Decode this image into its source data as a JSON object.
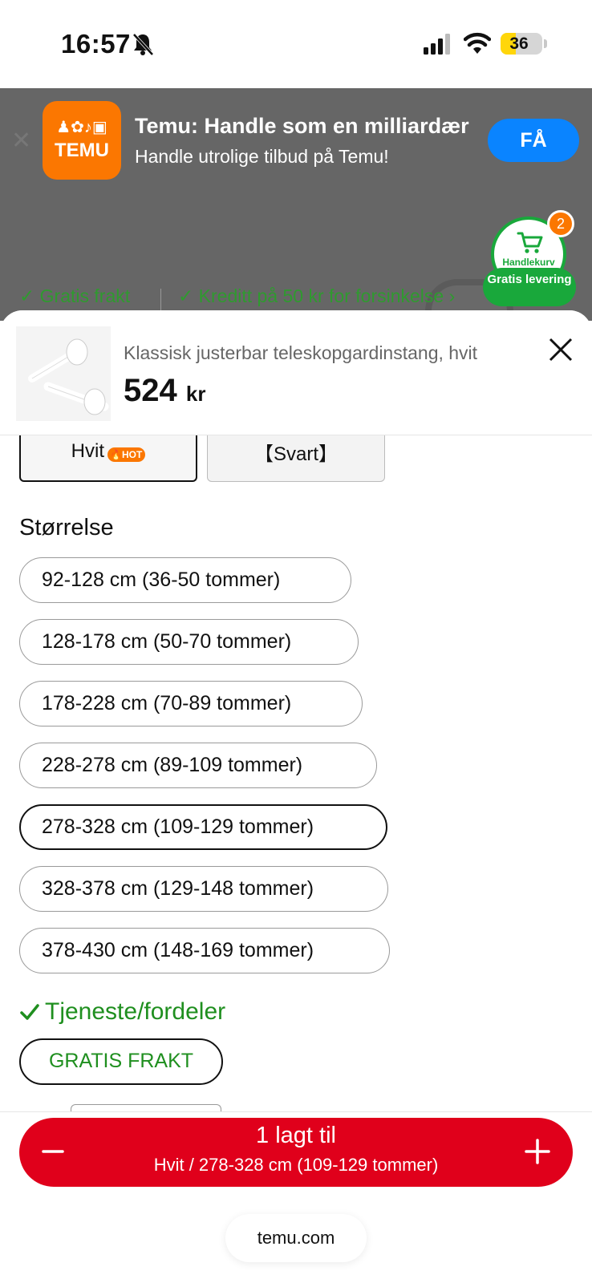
{
  "status_bar": {
    "time": "16:57",
    "battery": "36",
    "battery_level": 0.36
  },
  "app_banner": {
    "title": "Temu: Handle som en milliardær",
    "subtitle": "Handle utrolige tilbud på Temu!",
    "get_label": "FÅ",
    "icon_text": "TEMU"
  },
  "promo": {
    "free_shipping": "Gratis frakt",
    "credit": "Kreditt på 50 kr for forsinkelse"
  },
  "cart": {
    "label": "Handlekurv",
    "count": "2",
    "pill": "Gratis levering"
  },
  "product": {
    "title": "Klassisk justerbar teleskopgardinstang, hvit",
    "price": "524",
    "currency": "kr"
  },
  "colors": {
    "hvit": "Hvit",
    "hot": "HOT",
    "svart": "【Svart】"
  },
  "size_section": {
    "title": "Størrelse",
    "options": [
      "92-128 cm (36-50 tommer)",
      "128-178 cm (50-70 tommer)",
      "178-228 cm (70-89 tommer)",
      "228-278 cm (89-109 tommer)",
      "278-328 cm (109-129 tommer)",
      "328-378 cm (129-148 tommer)",
      "378-430 cm (148-169 tommer)"
    ],
    "selected_index": 4
  },
  "benefits": {
    "title": "Tjeneste/fordeler",
    "free_shipping": "GRATIS FRAKT"
  },
  "add_button": {
    "line1": "1 lagt til",
    "line2": "Hvit / 278-328 cm (109-129 tommer)"
  },
  "url": "temu.com",
  "theme": {
    "accent_red": "#e0001b",
    "green": "#1f8f1f",
    "orange": "#fb7701"
  }
}
